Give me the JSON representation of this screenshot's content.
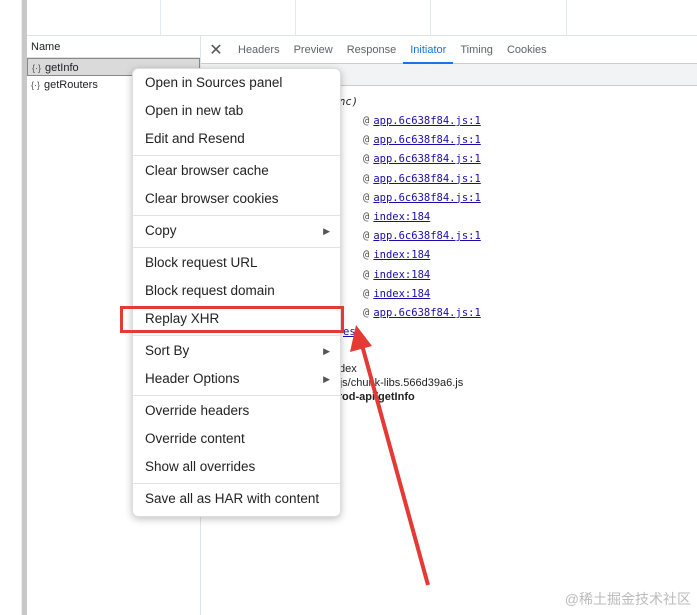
{
  "network": {
    "name_header": "Name",
    "requests": [
      {
        "name": "getInfo",
        "selected": true
      },
      {
        "name": "getRouters",
        "selected": false
      }
    ]
  },
  "detail": {
    "tabs": [
      "Headers",
      "Preview",
      "Response",
      "Initiator",
      "Timing",
      "Cookies"
    ],
    "active_tab": "Initiator",
    "async_label": "nc)",
    "stack": [
      "app.6c638f84.js:1",
      "app.6c638f84.js:1",
      "app.6c638f84.js:1",
      "app.6c638f84.js:1",
      "app.6c638f84.js:1",
      "index:184",
      "app.6c638f84.js:1",
      "index:184",
      "index:184",
      "index:184",
      "app.6c638f84.js:1"
    ],
    "stack_at": "@",
    "partial_link": "es",
    "tree": [
      "dex",
      "static/js/chunk-libs.566d39a6.js",
      ".vip/prod-api/getInfo"
    ]
  },
  "menu": {
    "groups": [
      [
        {
          "label": "Open in Sources panel"
        },
        {
          "label": "Open in new tab"
        },
        {
          "label": "Edit and Resend"
        }
      ],
      [
        {
          "label": "Clear browser cache"
        },
        {
          "label": "Clear browser cookies"
        }
      ],
      [
        {
          "label": "Copy",
          "submenu": true
        }
      ],
      [
        {
          "label": "Block request URL"
        },
        {
          "label": "Block request domain"
        },
        {
          "label": "Replay XHR",
          "highlighted": true
        }
      ],
      [
        {
          "label": "Sort By",
          "submenu": true
        },
        {
          "label": "Header Options",
          "submenu": true
        }
      ],
      [
        {
          "label": "Override headers"
        },
        {
          "label": "Override content"
        },
        {
          "label": "Show all overrides"
        }
      ],
      [
        {
          "label": "Save all as HAR with content"
        }
      ]
    ]
  },
  "annotation": {
    "color": "#e53935"
  },
  "watermark": "@稀土掘金技术社区"
}
